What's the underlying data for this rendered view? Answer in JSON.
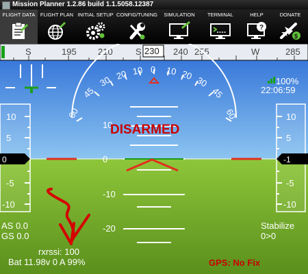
{
  "window": {
    "title": "Mission Planner 1.2.86 build 1.1.5058.12387"
  },
  "toolbar": {
    "items": [
      {
        "label": "FLIGHT DATA",
        "icon": "clipboard-icon"
      },
      {
        "label": "FLIGHT PLAN",
        "icon": "globe-icon"
      },
      {
        "label": "INITIAL SETUP",
        "icon": "gears-icon"
      },
      {
        "label": "CONFIG/TUNING",
        "icon": "wrench-icon"
      },
      {
        "label": "SIMULATION",
        "icon": "monitor-plane-icon"
      },
      {
        "label": "TERMINAL",
        "icon": "terminal-icon"
      },
      {
        "label": "HELP",
        "icon": "help-monitor-icon"
      },
      {
        "label": "DONATE",
        "icon": "plane-dollar-icon"
      }
    ]
  },
  "hud": {
    "heading_labels": [
      "S",
      "195",
      "210",
      "S",
      "230",
      "240",
      "255",
      "W",
      "285"
    ],
    "roll_labels": [
      "60",
      "45",
      "30",
      "20",
      "10",
      "0",
      "10",
      "20",
      "30",
      "45",
      "60"
    ],
    "pitch_labels": [
      "10",
      "0",
      "-10",
      "-20"
    ],
    "left_tape_labels": [
      "10",
      "5",
      "0",
      "-5",
      "-10"
    ],
    "left_tape_value": "0",
    "right_tape_labels": [
      "10",
      "5",
      "0",
      "-5",
      "-10"
    ],
    "right_tape_value": "-1",
    "status": "DISARMED",
    "battery_remaining": "100%",
    "time": "22:06:59",
    "airspeed": "AS 0.0",
    "groundspeed": "GS 0.0",
    "rssi": "rxrssi: 100",
    "battery": "Bat 11.98v 0 A 99%",
    "gps": "GPS: No Fix",
    "mode": "Stabilize",
    "waypoint": "0>0",
    "colors": {
      "sky": "#5ea4e6",
      "ground": "#7db12e",
      "warning": "#c80000",
      "attitude_marker": "#e03020"
    }
  }
}
